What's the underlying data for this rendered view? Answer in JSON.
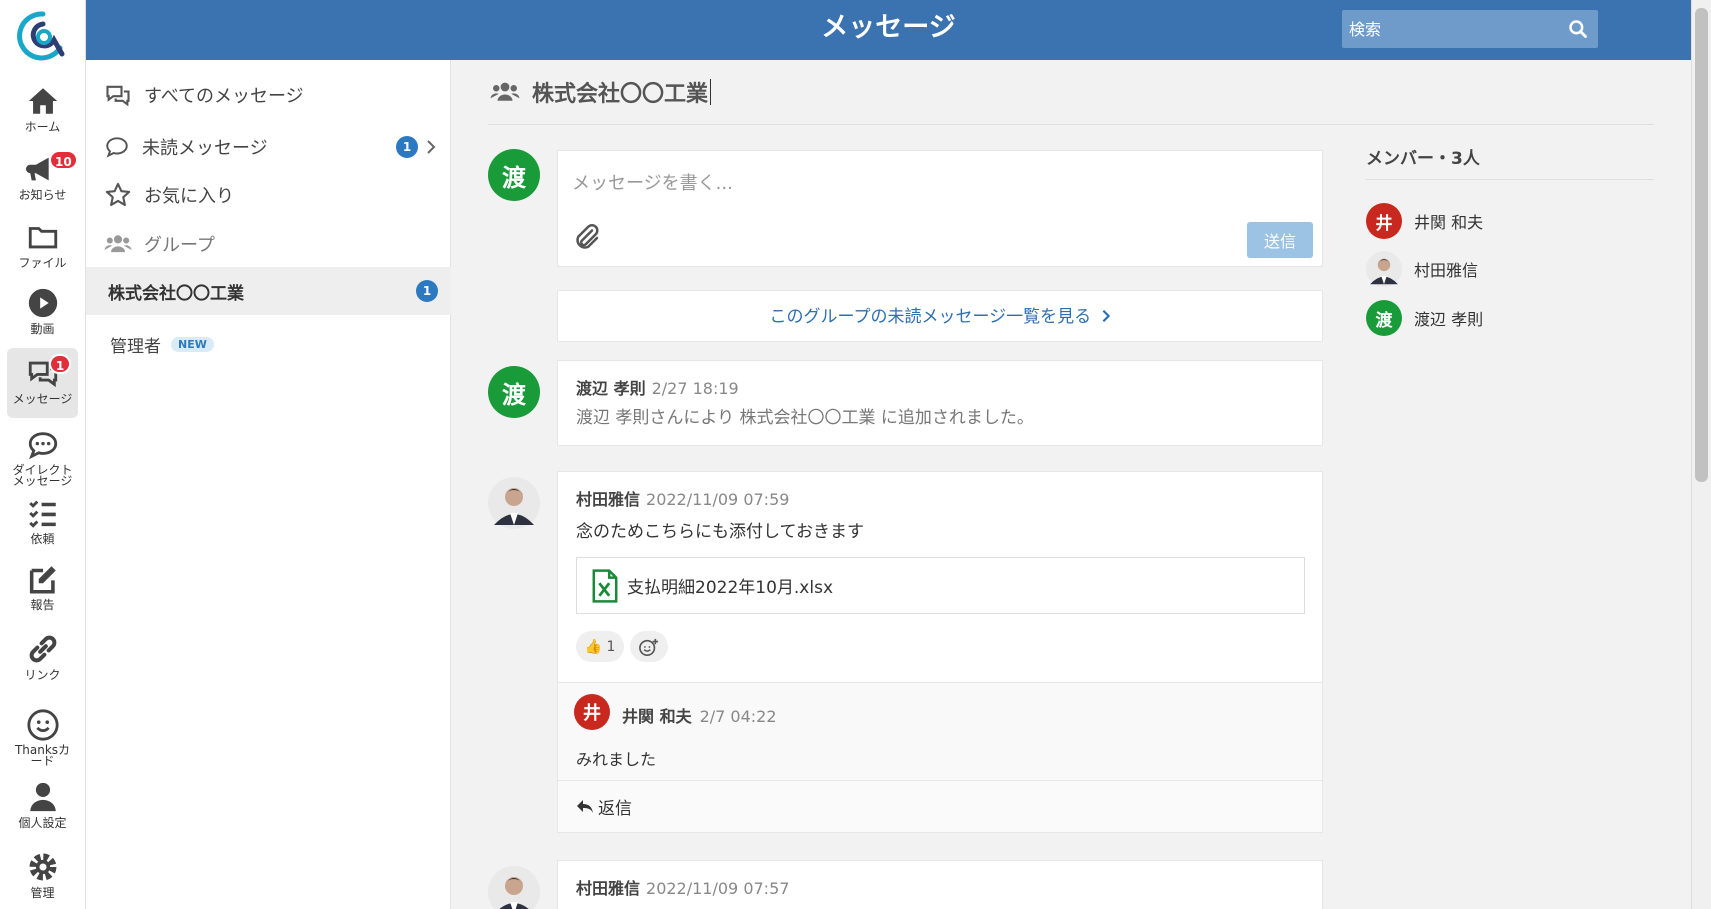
{
  "header": {
    "title": "メッセージ",
    "search_placeholder": "検索",
    "user_initial": "渡"
  },
  "rail": {
    "items": [
      {
        "label": "ホーム",
        "icon": "home-icon"
      },
      {
        "label": "お知らせ",
        "icon": "megaphone-icon",
        "badge": "10"
      },
      {
        "label": "ファイル",
        "icon": "folder-icon"
      },
      {
        "label": "動画",
        "icon": "play-icon"
      },
      {
        "label": "メッセージ",
        "icon": "chat-icon",
        "badge": "1",
        "active": true
      },
      {
        "label": "ダイレクト\nメッセージ",
        "label_line1": "ダイレクト",
        "label_line2": "メッセージ",
        "icon": "direct-message-icon"
      },
      {
        "label": "依頼",
        "icon": "checklist-icon"
      },
      {
        "label": "報告",
        "icon": "edit-icon"
      },
      {
        "label": "リンク",
        "icon": "link-icon"
      },
      {
        "label_line1": "Thanksカ",
        "label_line2": "ード",
        "icon": "smile-icon"
      },
      {
        "label": "個人設定",
        "icon": "person-icon"
      },
      {
        "label": "管理",
        "icon": "gear-icon"
      }
    ]
  },
  "channels": {
    "all": "すべてのメッセージ",
    "unread": "未読メッセージ",
    "unread_count": "1",
    "favorites": "お気に入り",
    "groups_heading": "グループ",
    "group_selected": "株式会社〇〇工業",
    "group_selected_count": "1",
    "group_admin": "管理者",
    "new_tag": "NEW"
  },
  "main": {
    "group_name": "株式会社〇〇工業",
    "composer": {
      "placeholder": "メッセージを書く...",
      "send_label": "送信",
      "avatar": "渡"
    },
    "unread_link": "このグループの未読メッセージ一覧を見る",
    "messages": [
      {
        "avatar": "渡",
        "author": "渡辺 孝則",
        "time": "2/27 18:19",
        "body": "渡辺 孝則さんにより 株式会社〇〇工業 に追加されました。"
      },
      {
        "author": "村田雅信",
        "time": "2022/11/09 07:59",
        "body": "念のためこちらにも添付しておきます",
        "attachment": "支払明細2022年10月.xlsx",
        "reaction": {
          "emoji": "👍",
          "count": "1"
        },
        "reply": {
          "avatar": "井",
          "author": "井関 和夫",
          "time": "2/7 04:22",
          "body": "みれました"
        },
        "reply_label": "返信"
      },
      {
        "author": "村田雅信",
        "time": "2022/11/09 07:57"
      }
    ]
  },
  "members": {
    "heading": "メンバー・3人",
    "list": [
      {
        "initial": "井",
        "name": "井関 和夫",
        "color": "#c8281d"
      },
      {
        "name": "村田雅信",
        "photo": true
      },
      {
        "initial": "渡",
        "name": "渡辺 孝則",
        "color": "#1a9b3a"
      }
    ]
  },
  "colors": {
    "header": "#3a73b0",
    "accent": "#2c79c2",
    "badge": "#e02f3a",
    "green": "#1a9b3a",
    "red": "#c8281d"
  }
}
